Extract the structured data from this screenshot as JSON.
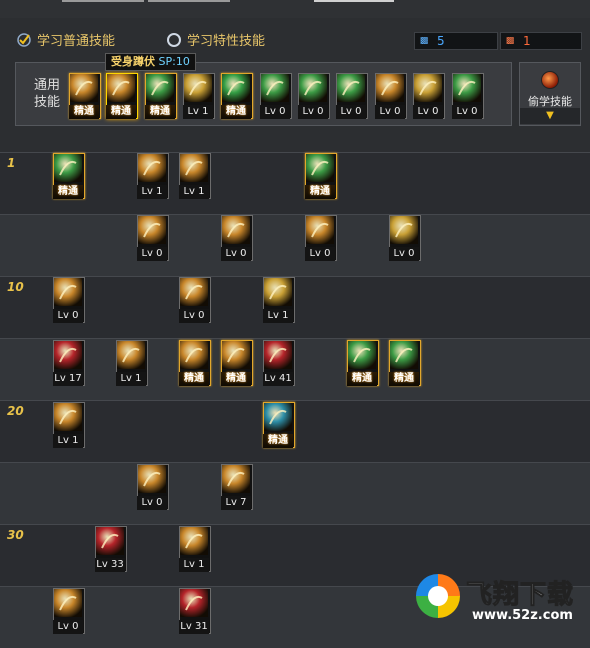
{
  "tabs": {
    "normal_label": "学习普通技能",
    "special_label": "学习特性技能"
  },
  "counters": {
    "blue_value": "5",
    "red_value": "1"
  },
  "general": {
    "label": "通用技能",
    "skills": [
      {
        "tag": "精通",
        "style": "gold",
        "color": "#c8862a"
      },
      {
        "tag": "精通",
        "style": "gold",
        "color": "#c8862a"
      },
      {
        "tag": "精通",
        "style": "gold",
        "color": "#3c9b45"
      },
      {
        "tag": "Lv 1",
        "style": "plain",
        "color": "#c9a035"
      },
      {
        "tag": "精通",
        "style": "gold",
        "color": "#35a046"
      },
      {
        "tag": "Lv 0",
        "style": "plain",
        "color": "#3c9b45"
      },
      {
        "tag": "Lv 0",
        "style": "plain",
        "color": "#3c9b45"
      },
      {
        "tag": "Lv 0",
        "style": "plain",
        "color": "#3c9b45"
      },
      {
        "tag": "Lv 0",
        "style": "plain",
        "color": "#c8862a"
      },
      {
        "tag": "Lv 0",
        "style": "plain",
        "color": "#c9a035"
      },
      {
        "tag": "Lv 0",
        "style": "plain",
        "color": "#3c9b45"
      }
    ]
  },
  "steal": {
    "label": "偷学技能",
    "arrow": "▼"
  },
  "tooltip": {
    "name": "受身蹲伏",
    "sp": "SP:10"
  },
  "tree": {
    "levels": [
      "1",
      "10",
      "20",
      "30"
    ],
    "skills": [
      {
        "tag": "精通",
        "style": "gold",
        "color": "#3c9b45"
      },
      {
        "tag": "Lv 1",
        "style": "plain",
        "color": "#c8862a"
      },
      {
        "tag": "Lv 1",
        "style": "plain",
        "color": "#c8862a"
      },
      {
        "tag": "精通",
        "style": "gold",
        "color": "#3c9b45"
      },
      {
        "tag": "Lv 0",
        "style": "plain",
        "color": "#c8862a"
      },
      {
        "tag": "Lv 0",
        "style": "plain",
        "color": "#c8862a"
      },
      {
        "tag": "Lv 0",
        "style": "plain",
        "color": "#c8862a"
      },
      {
        "tag": "Lv 0",
        "style": "plain",
        "color": "#c9a035"
      },
      {
        "tag": "Lv 0",
        "style": "plain",
        "color": "#c8862a"
      },
      {
        "tag": "Lv 0",
        "style": "plain",
        "color": "#c8862a"
      },
      {
        "tag": "Lv 1",
        "style": "plain",
        "color": "#c9a035"
      },
      {
        "tag": "Lv 17",
        "style": "plain",
        "color": "#b5242a"
      },
      {
        "tag": "Lv 1",
        "style": "plain",
        "color": "#c8862a"
      },
      {
        "tag": "精通",
        "style": "gold",
        "color": "#c8862a"
      },
      {
        "tag": "精通",
        "style": "gold",
        "color": "#c8862a"
      },
      {
        "tag": "Lv 41",
        "style": "plain",
        "color": "#b5242a"
      },
      {
        "tag": "精通",
        "style": "gold",
        "color": "#3c9b45"
      },
      {
        "tag": "精通",
        "style": "gold",
        "color": "#3c9b45"
      },
      {
        "tag": "Lv 1",
        "style": "plain",
        "color": "#c8862a"
      },
      {
        "tag": "精通",
        "style": "gold",
        "color": "#2d8fa8"
      },
      {
        "tag": "Lv 0",
        "style": "plain",
        "color": "#c8862a"
      },
      {
        "tag": "Lv 7",
        "style": "plain",
        "color": "#c8862a"
      },
      {
        "tag": "Lv 33",
        "style": "plain",
        "color": "#b5242a"
      },
      {
        "tag": "Lv 1",
        "style": "plain",
        "color": "#c8862a"
      },
      {
        "tag": "Lv 0",
        "style": "plain",
        "color": "#c8862a"
      },
      {
        "tag": "Lv 31",
        "style": "plain",
        "color": "#b5242a"
      }
    ]
  },
  "watermark": {
    "name": "飞翔下载",
    "url": "www.52z.com"
  }
}
